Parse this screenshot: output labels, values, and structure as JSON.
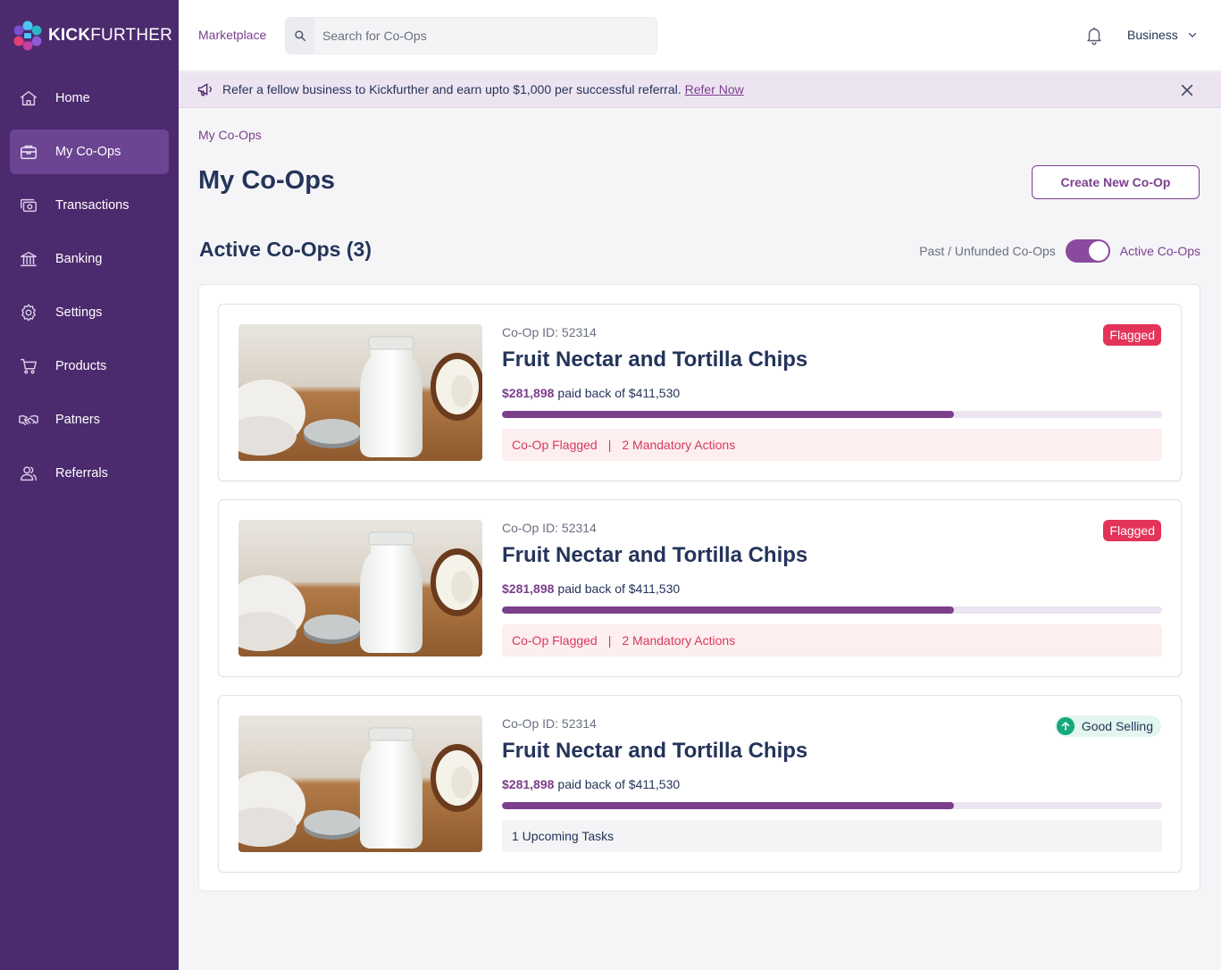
{
  "brand": {
    "name_bold": "KICK",
    "name_rest": "FURTHER"
  },
  "nav": [
    {
      "label": "Home",
      "icon": "home-icon"
    },
    {
      "label": "My Co-Ops",
      "icon": "briefcase-icon",
      "active": true
    },
    {
      "label": "Transactions",
      "icon": "transactions-icon"
    },
    {
      "label": "Banking",
      "icon": "bank-icon"
    },
    {
      "label": "Settings",
      "icon": "gear-icon"
    },
    {
      "label": "Products",
      "icon": "cart-icon"
    },
    {
      "label": "Patners",
      "icon": "handshake-icon"
    },
    {
      "label": "Referrals",
      "icon": "users-icon"
    }
  ],
  "topbar": {
    "marketplace": "Marketplace",
    "search_placeholder": "Search for Co-Ops",
    "account": "Business"
  },
  "banner": {
    "text": "Refer a fellow business to Kickfurther and earn upto $1,000 per successful referral.",
    "link": "Refer Now"
  },
  "breadcrumb": "My Co-Ops",
  "page_title": "My Co-Ops",
  "create_button": "Create New Co-Op",
  "section_title": "Active Co-Ops (3)",
  "toggle": {
    "left_label": "Past / Unfunded Co-Ops",
    "right_label": "Active Co-Ops",
    "on": true
  },
  "coops": [
    {
      "id_label": "Co-Op ID: 52314",
      "name": "Fruit Nectar and Tortilla Chips",
      "paid": "$281,898",
      "paid_suffix": "paid back of $411,530",
      "progress": 0.685,
      "badge": "Flagged",
      "status": {
        "type": "flag",
        "left": "Co-Op Flagged",
        "sep": "|",
        "right": "2 Mandatory Actions"
      }
    },
    {
      "id_label": "Co-Op ID: 52314",
      "name": "Fruit Nectar and Tortilla Chips",
      "paid": "$281,898",
      "paid_suffix": "paid back of $411,530",
      "progress": 0.685,
      "badge": "Flagged",
      "status": {
        "type": "flag",
        "left": "Co-Op Flagged",
        "sep": "|",
        "right": "2 Mandatory Actions"
      }
    },
    {
      "id_label": "Co-Op ID: 52314",
      "name": "Fruit Nectar and Tortilla Chips",
      "paid": "$281,898",
      "paid_suffix": "paid back of $411,530",
      "progress": 0.685,
      "badge": "Good Selling",
      "status": {
        "type": "tasks",
        "text": "1 Upcoming Tasks"
      }
    }
  ],
  "colors": {
    "sidebar": "#4b2a6e",
    "accent": "#7b3f8c",
    "flag": "#e43358",
    "good": "#14a97a"
  }
}
